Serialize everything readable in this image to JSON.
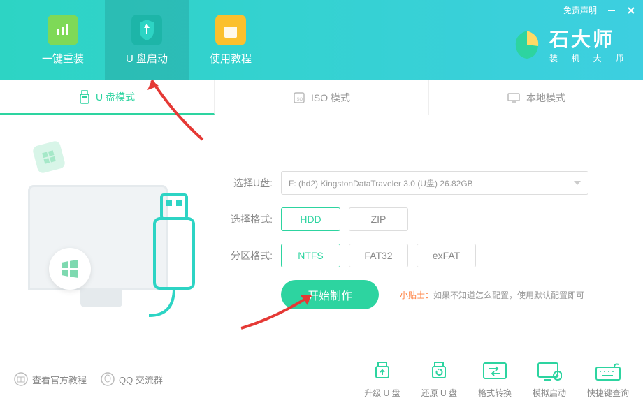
{
  "window": {
    "disclaimer": "免责声明"
  },
  "brand": {
    "name": "石大师",
    "tagline": "装 机 大 师"
  },
  "nav": [
    {
      "label": "一键重装"
    },
    {
      "label": "U 盘启动"
    },
    {
      "label": "使用教程"
    }
  ],
  "subtabs": [
    {
      "label": "U 盘模式"
    },
    {
      "label": "ISO 模式"
    },
    {
      "label": "本地模式"
    }
  ],
  "form": {
    "select_disk_label": "选择U盘:",
    "select_disk_value": "F: (hd2) KingstonDataTraveler 3.0 (U盘) 26.82GB",
    "select_format_label": "选择格式:",
    "format_options": [
      "HDD",
      "ZIP"
    ],
    "partition_label": "分区格式:",
    "partition_options": [
      "NTFS",
      "FAT32",
      "exFAT"
    ]
  },
  "action": {
    "start": "开始制作"
  },
  "tip": {
    "label": "小贴士：",
    "text": "如果不知道怎么配置，使用默认配置即可"
  },
  "footer_links": {
    "tutorial": "查看官方教程",
    "qq": "QQ 交流群"
  },
  "footer_actions": [
    {
      "label": "升级 U 盘"
    },
    {
      "label": "还原 U 盘"
    },
    {
      "label": "格式转换"
    },
    {
      "label": "模拟启动"
    },
    {
      "label": "快捷键查询"
    }
  ]
}
